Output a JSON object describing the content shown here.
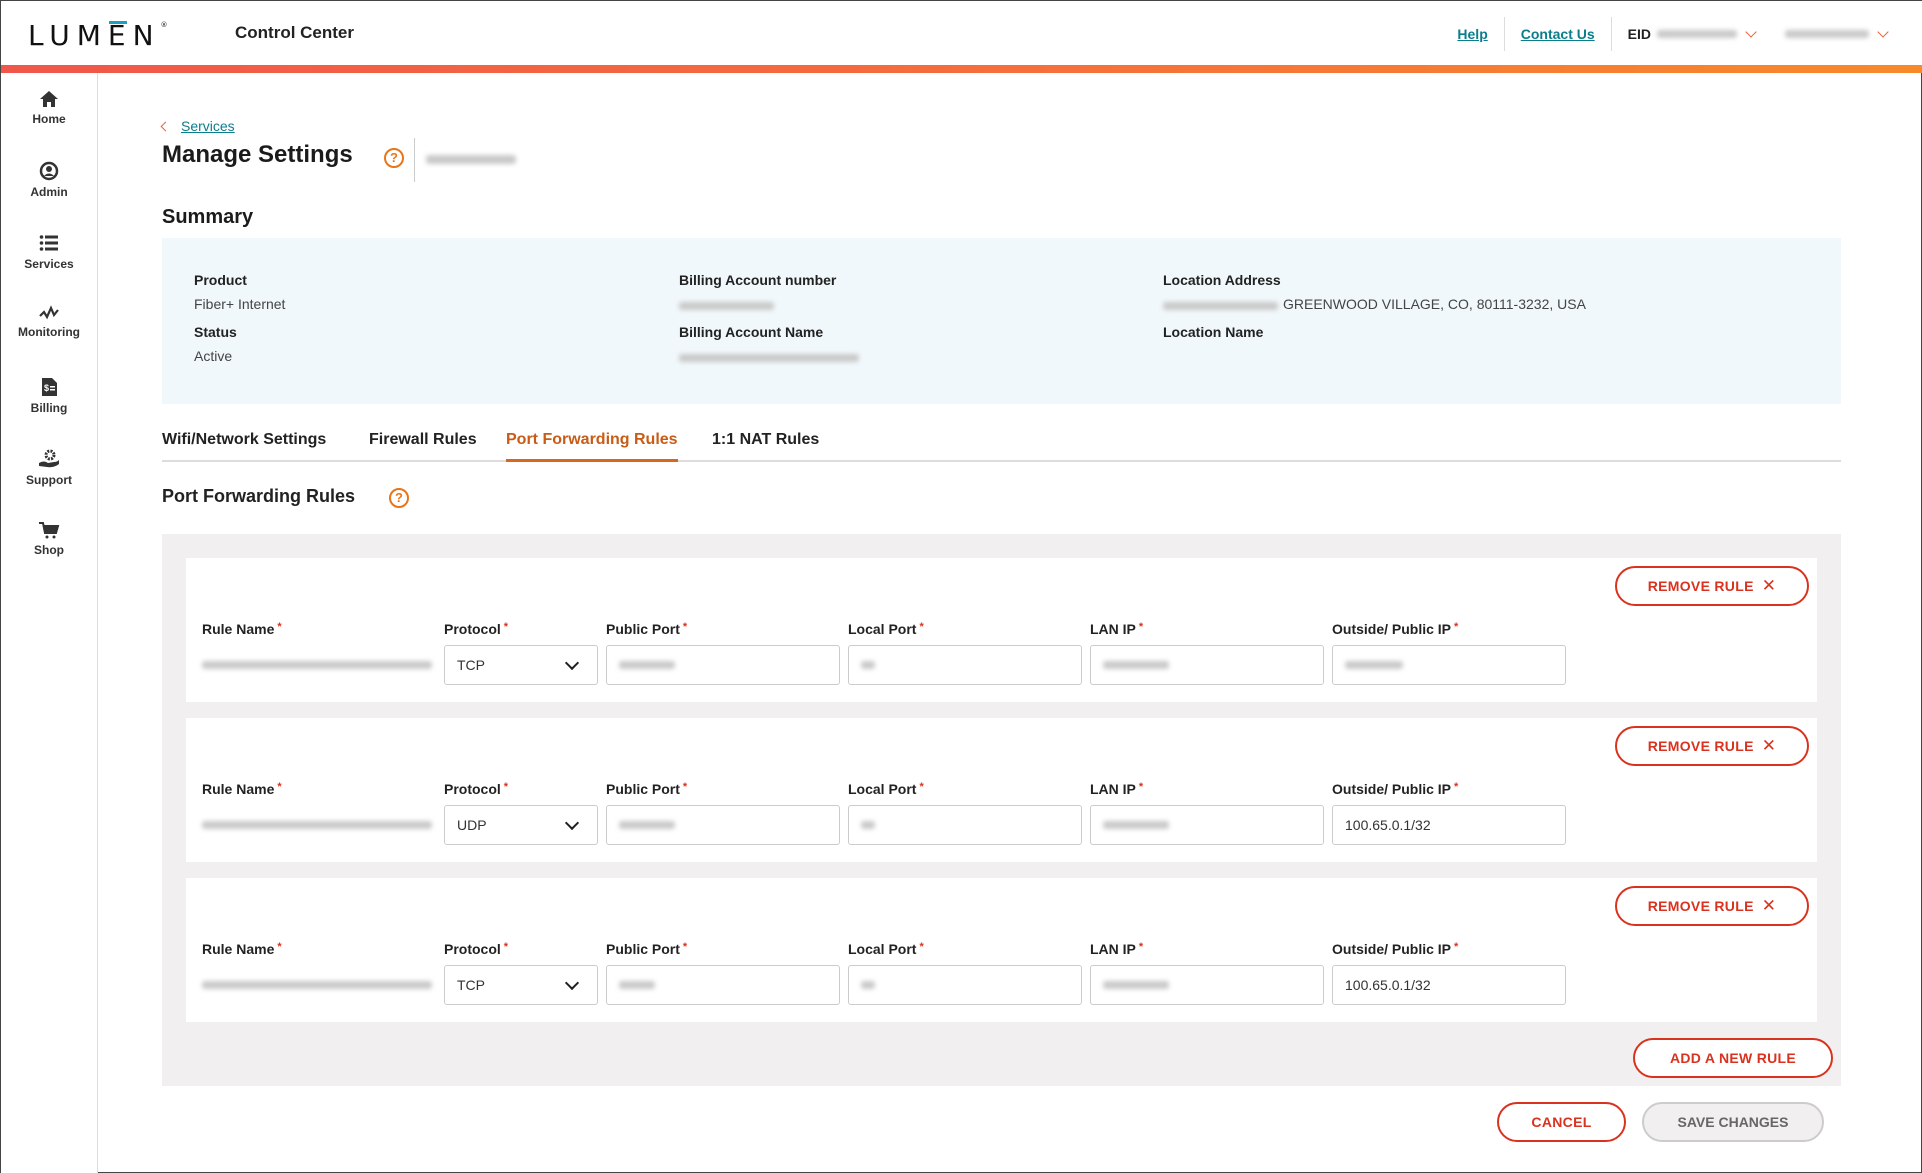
{
  "header": {
    "logo_text": "LUMEN",
    "app_title": "Control Center",
    "links": [
      "Help",
      "Contact Us"
    ],
    "eid_label": "EID",
    "eid_value": "[redacted]",
    "user_value": "[redacted]"
  },
  "sidebar": {
    "items": [
      {
        "label": "Home",
        "icon": "home-icon"
      },
      {
        "label": "Admin",
        "icon": "user-circle-icon"
      },
      {
        "label": "Services",
        "icon": "list-icon"
      },
      {
        "label": "Monitoring",
        "icon": "pulse-icon"
      },
      {
        "label": "Billing",
        "icon": "invoice-icon"
      },
      {
        "label": "Support",
        "icon": "support-hand-gear-icon"
      },
      {
        "label": "Shop",
        "icon": "cart-icon"
      }
    ]
  },
  "breadcrumb": {
    "back_label": "Services"
  },
  "page": {
    "title": "Manage Settings",
    "service_id": "[redacted]"
  },
  "summary": {
    "title": "Summary",
    "product_label": "Product",
    "product_value": "Fiber+ Internet",
    "status_label": "Status",
    "status_value": "Active",
    "billing_number_label": "Billing Account number",
    "billing_number_value": "[redacted]",
    "billing_name_label": "Billing Account Name",
    "billing_name_value": "[redacted]",
    "location_address_label": "Location Address",
    "location_address_value": "GREENWOOD VILLAGE, CO, 80111-3232, USA",
    "location_name_label": "Location Name",
    "location_name_value": ""
  },
  "tabs": [
    {
      "label": "Wifi/Network Settings",
      "active": false
    },
    {
      "label": "Firewall Rules",
      "active": false
    },
    {
      "label": "Port Forwarding Rules",
      "active": true
    },
    {
      "label": "1:1 NAT Rules",
      "active": false
    }
  ],
  "section": {
    "title": "Port Forwarding Rules"
  },
  "field_labels": {
    "rule_name": "Rule Name",
    "protocol": "Protocol",
    "public_port": "Public Port",
    "local_port": "Local Port",
    "lan_ip": "LAN IP",
    "outside_ip": "Outside/ Public IP",
    "required_marker": "*"
  },
  "rules": [
    {
      "rule_name": "[redacted]",
      "protocol": "TCP",
      "public_port": "[redacted]",
      "local_port": "[redacted]",
      "lan_ip": "[redacted]",
      "outside_ip": "[redacted]"
    },
    {
      "rule_name": "[redacted]",
      "protocol": "UDP",
      "public_port": "[redacted]",
      "local_port": "[redacted]",
      "lan_ip": "[redacted]",
      "outside_ip": "100.65.0.1/32"
    },
    {
      "rule_name": "[redacted]",
      "protocol": "TCP",
      "public_port": "[redacted]",
      "local_port": "[redacted]",
      "lan_ip": "[redacted]",
      "outside_ip": "100.65.0.1/32"
    }
  ],
  "buttons": {
    "remove_rule": "REMOVE RULE",
    "add_rule": "ADD A NEW RULE",
    "cancel": "CANCEL",
    "save": "SAVE CHANGES"
  },
  "colors": {
    "accent_orange": "#e8751a",
    "danger_red": "#d9321f",
    "link_teal": "#0b7e8c",
    "summary_bg": "#f1f8fb"
  }
}
